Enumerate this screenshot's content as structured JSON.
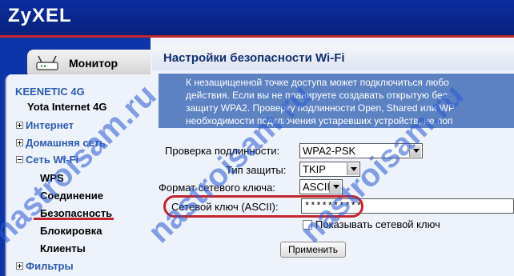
{
  "brand": {
    "logo": "ZyXEL"
  },
  "left_nav": {
    "monitor_tab": "Монитор",
    "device": "KEENETIC 4G",
    "items": [
      {
        "label": "Yota Internet 4G",
        "expander": "none"
      },
      {
        "label": "Интернет",
        "expander": "plus"
      },
      {
        "label": "Домашняя сеть",
        "expander": "plus"
      },
      {
        "label": "Сеть Wi-Fi",
        "expander": "minus"
      },
      {
        "label": "WPS",
        "expander": "none"
      },
      {
        "label": "Соединение",
        "expander": "none"
      },
      {
        "label": "Безопасность",
        "expander": "none",
        "selected": true
      },
      {
        "label": "Блокировка",
        "expander": "none"
      },
      {
        "label": "Клиенты",
        "expander": "none"
      },
      {
        "label": "Фильтры",
        "expander": "plus"
      }
    ]
  },
  "main": {
    "title": "Настройки безопасности Wi-Fi",
    "description_lines": [
      "К незащищенной точке доступа может подключиться любо",
      "действия. Если вы не планируете создавать открытую бес",
      "защиту WPA2. Проверку подлинности Open, Shared или WP",
      "необходимости подключения устаревших устройств, не поп"
    ],
    "auth_label": "Проверка подлинности:",
    "auth_value": "WPA2-PSK",
    "protection_label": "Тип защиты:",
    "protection_value": "TKIP",
    "key_format_label": "Формат сетевого ключа:",
    "key_format_value": "ASCII",
    "key_label": "Сетевой ключ (ASCII):",
    "key_value": "**********",
    "show_key_label": "Показывать сетевой ключ",
    "show_key_checked": false,
    "apply_button": "Применить"
  },
  "watermarks": [
    "nastroisam.ru",
    "nastroisam.ru",
    "nastroisam.ru"
  ],
  "colors": {
    "header": "#0b2fa0",
    "accent_red": "#c3262c",
    "desc_bg": "#5d82c2",
    "nav_blue": "#2a5db0"
  }
}
